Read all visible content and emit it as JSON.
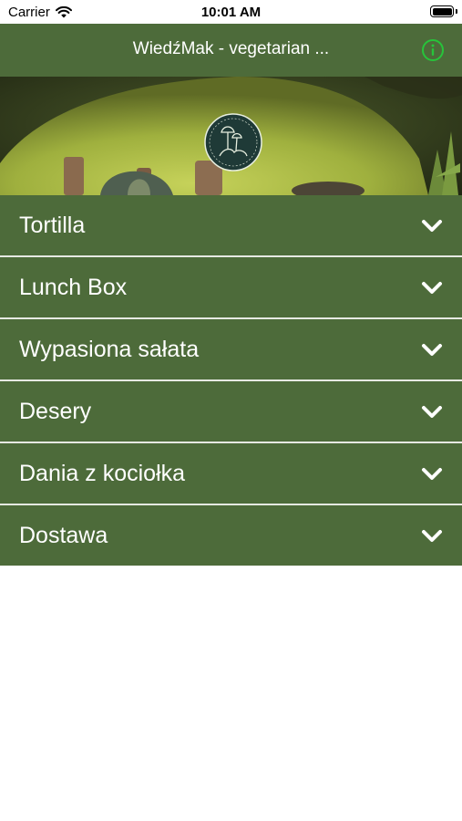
{
  "status_bar": {
    "carrier": "Carrier",
    "time": "10:01 AM",
    "wifi_icon": "wifi-icon",
    "battery_icon": "battery-icon"
  },
  "nav": {
    "title": "WiedźMak - vegetarian ...",
    "info_icon": "info-icon",
    "background": "#4d6b3a",
    "info_color": "#27c43a"
  },
  "hero": {
    "logo_icon": "mushroom-logo-icon"
  },
  "menu": {
    "items": [
      {
        "label": "Tortilla"
      },
      {
        "label": "Lunch Box"
      },
      {
        "label": "Wypasiona sałata"
      },
      {
        "label": "Desery"
      },
      {
        "label": "Dania z kociołka"
      },
      {
        "label": "Dostawa"
      }
    ],
    "chevron_icon": "chevron-down-icon",
    "item_background": "#4d6b3a",
    "separator_color": "#e6e9e2"
  }
}
